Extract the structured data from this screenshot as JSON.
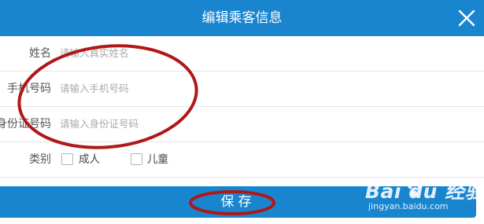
{
  "dialog": {
    "title": "编辑乘客信息"
  },
  "form": {
    "name": {
      "label": "姓名",
      "placeholder": "请输入真实姓名",
      "value": ""
    },
    "phone": {
      "label": "手机号码",
      "placeholder": "请输入手机号码",
      "value": ""
    },
    "idcard": {
      "label": "身份证号码",
      "placeholder": "请输入身份证号码",
      "value": ""
    },
    "category": {
      "label": "类别",
      "options": [
        {
          "label": "成人",
          "checked": false
        },
        {
          "label": "儿童",
          "checked": false
        }
      ]
    }
  },
  "actions": {
    "save_label": "保存"
  },
  "watermark": {
    "brand": "Bai du 经验",
    "url": "jingyan.baidu.com"
  },
  "colors": {
    "primary": "#1a85cf",
    "annotation": "#b01818"
  }
}
